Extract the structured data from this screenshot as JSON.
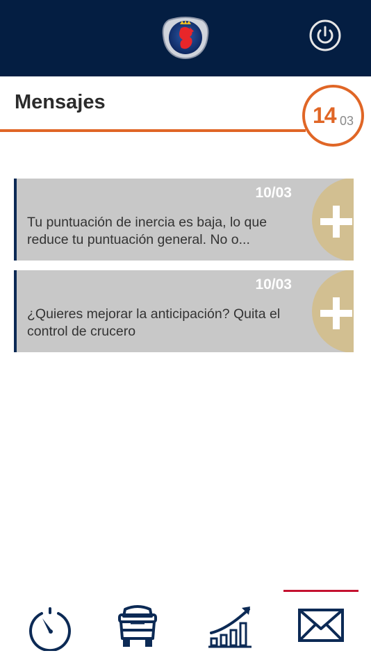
{
  "header": {
    "logo_icon": "scania-griffin-logo",
    "power_icon": "power-icon",
    "background_color": "#041e42"
  },
  "page": {
    "title": "Mensajes",
    "accent_color": "#e06626",
    "date_badge": {
      "day": "14",
      "month": "03"
    }
  },
  "messages": [
    {
      "date": "10/03",
      "text": "Tu puntuación de inercia es baja, lo que reduce tu puntuación general. No o...",
      "expand_icon": "plus-icon"
    },
    {
      "date": "10/03",
      "text": "¿Quieres mejorar la anticipación? Quita el control de crucero",
      "expand_icon": "plus-icon"
    }
  ],
  "bottom_nav": {
    "items": [
      {
        "icon": "speedometer-icon",
        "active": false
      },
      {
        "icon": "trucks-icon",
        "active": false
      },
      {
        "icon": "bar-chart-trend-icon",
        "active": false
      },
      {
        "icon": "envelope-icon",
        "active": true
      }
    ],
    "active_color": "#c41230",
    "icon_color": "#0c2a55"
  }
}
